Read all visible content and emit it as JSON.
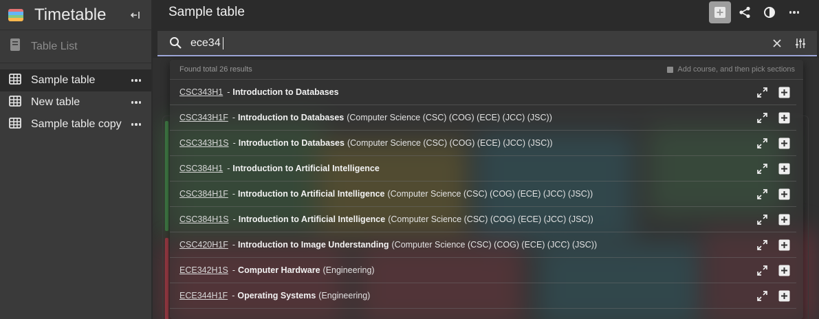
{
  "app": {
    "title": "Timetable"
  },
  "sidebar": {
    "table_list_label": "Table List",
    "items": [
      {
        "label": "Sample table",
        "active": true
      },
      {
        "label": "New table",
        "active": false
      },
      {
        "label": "Sample table copy",
        "active": false
      }
    ]
  },
  "header": {
    "title": "Sample table"
  },
  "search": {
    "value": "ece34",
    "placeholder": ""
  },
  "results": {
    "summary": "Found total 26 results",
    "hint": "Add course, and then pick sections",
    "items": [
      {
        "code": "CSC343H1",
        "sep": "-",
        "name": "Introduction to Databases",
        "desc": ""
      },
      {
        "code": "CSC343H1F",
        "sep": "-",
        "name": "Introduction to Databases",
        "desc": "(Computer Science (CSC) (COG) (ECE) (JCC) (JSC))"
      },
      {
        "code": "CSC343H1S",
        "sep": "-",
        "name": "Introduction to Databases",
        "desc": "(Computer Science (CSC) (COG) (ECE) (JCC) (JSC))"
      },
      {
        "code": "CSC384H1",
        "sep": "-",
        "name": "Introduction to Artificial Intelligence",
        "desc": ""
      },
      {
        "code": "CSC384H1F",
        "sep": "-",
        "name": "Introduction to Artificial Intelligence",
        "desc": "(Computer Science (CSC) (COG) (ECE) (JCC) (JSC))"
      },
      {
        "code": "CSC384H1S",
        "sep": "-",
        "name": "Introduction to Artificial Intelligence",
        "desc": "(Computer Science (CSC) (COG) (ECE) (JCC) (JSC))"
      },
      {
        "code": "CSC420H1F",
        "sep": "-",
        "name": "Introduction to Image Understanding",
        "desc": "(Computer Science (CSC) (COG) (ECE) (JCC) (JSC))"
      },
      {
        "code": "ECE342H1S",
        "sep": "-",
        "name": "Computer Hardware",
        "desc": "(Engineering)"
      },
      {
        "code": "ECE344H1F",
        "sep": "-",
        "name": "Operating Systems",
        "desc": "(Engineering)"
      }
    ]
  },
  "colors": {
    "accent": "#9fa8da",
    "bg_green": "#3f7a45",
    "bg_red": "#8a3540",
    "bg_yellow": "#8a7a2c",
    "bg_teal": "#2c6c7a"
  },
  "icons": {
    "app": "calendar-icon",
    "collapse": "collapse-sidebar-icon",
    "table_list": "book-icon",
    "table": "table-grid-icon",
    "more": "more-horizontal-icon",
    "add": "add-box-icon",
    "share": "share-icon",
    "contrast": "contrast-icon",
    "search": "search-icon",
    "clear": "close-icon",
    "filter": "tune-icon",
    "expand": "expand-icon"
  }
}
